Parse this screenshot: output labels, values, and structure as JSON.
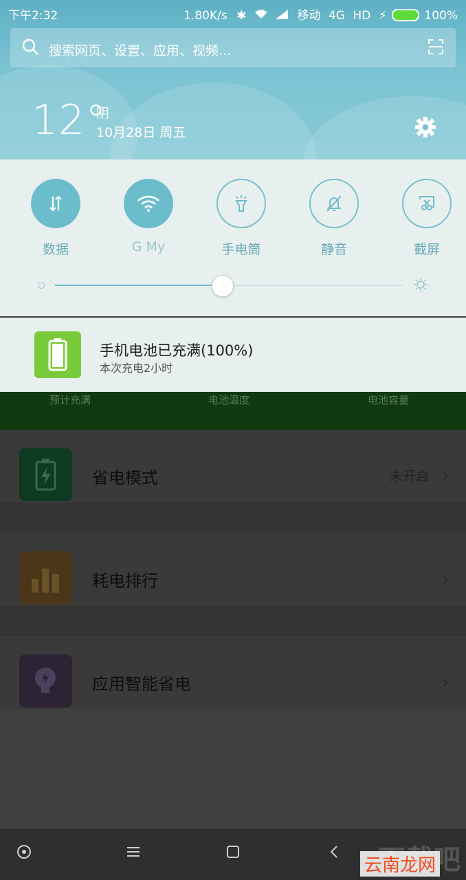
{
  "status_bar": {
    "time": "下午2:32",
    "network_speed": "1.80K/s",
    "carrier": "移动",
    "network_type": "4G",
    "hd": "HD",
    "battery": "100%"
  },
  "search": {
    "placeholder": "搜索网页、设置、应用、视频..."
  },
  "weather": {
    "temperature": "12°",
    "condition": "阴",
    "date": "10月28日 周五"
  },
  "quick_settings": {
    "tiles": [
      {
        "label": "数据",
        "state": "on",
        "icon": "data-arrows-icon"
      },
      {
        "label": "G      My",
        "state": "on",
        "icon": "wifi-icon"
      },
      {
        "label": "手电筒",
        "state": "off",
        "icon": "flashlight-icon"
      },
      {
        "label": "静音",
        "state": "off",
        "icon": "bell-mute-icon"
      },
      {
        "label": "截屏",
        "state": "off",
        "icon": "screenshot-icon"
      }
    ],
    "brightness_level": 0.48
  },
  "notification": {
    "title": "手机电池已充满(100%)",
    "subtitle": "本次充电2小时",
    "icon": "battery-full-icon"
  },
  "background_app": {
    "strip_labels": [
      "预计充满",
      "电池温度",
      "电池容量"
    ],
    "rows": [
      {
        "title": "省电模式",
        "status": "未开启",
        "icon": "battery-bolt-icon",
        "icon_color": "#0e3a22"
      },
      {
        "title": "耗电排行",
        "status": "",
        "icon": "bar-chart-icon",
        "icon_color": "#4a3618"
      },
      {
        "title": "应用智能省电",
        "status": "",
        "icon": "lightbulb-bolt-icon",
        "icon_color": "#2c2335"
      }
    ]
  },
  "nav_bar": {
    "items": [
      "home-circle-icon",
      "menu-icon",
      "square-icon",
      "back-icon"
    ]
  },
  "watermark": {
    "text": "下载吧",
    "badge": "云南龙网"
  },
  "colors": {
    "accent": "#6cbdcc",
    "shade_top": "#5eb0c5",
    "panel": "#e8f0ef",
    "battery_green": "#7acb3c"
  }
}
